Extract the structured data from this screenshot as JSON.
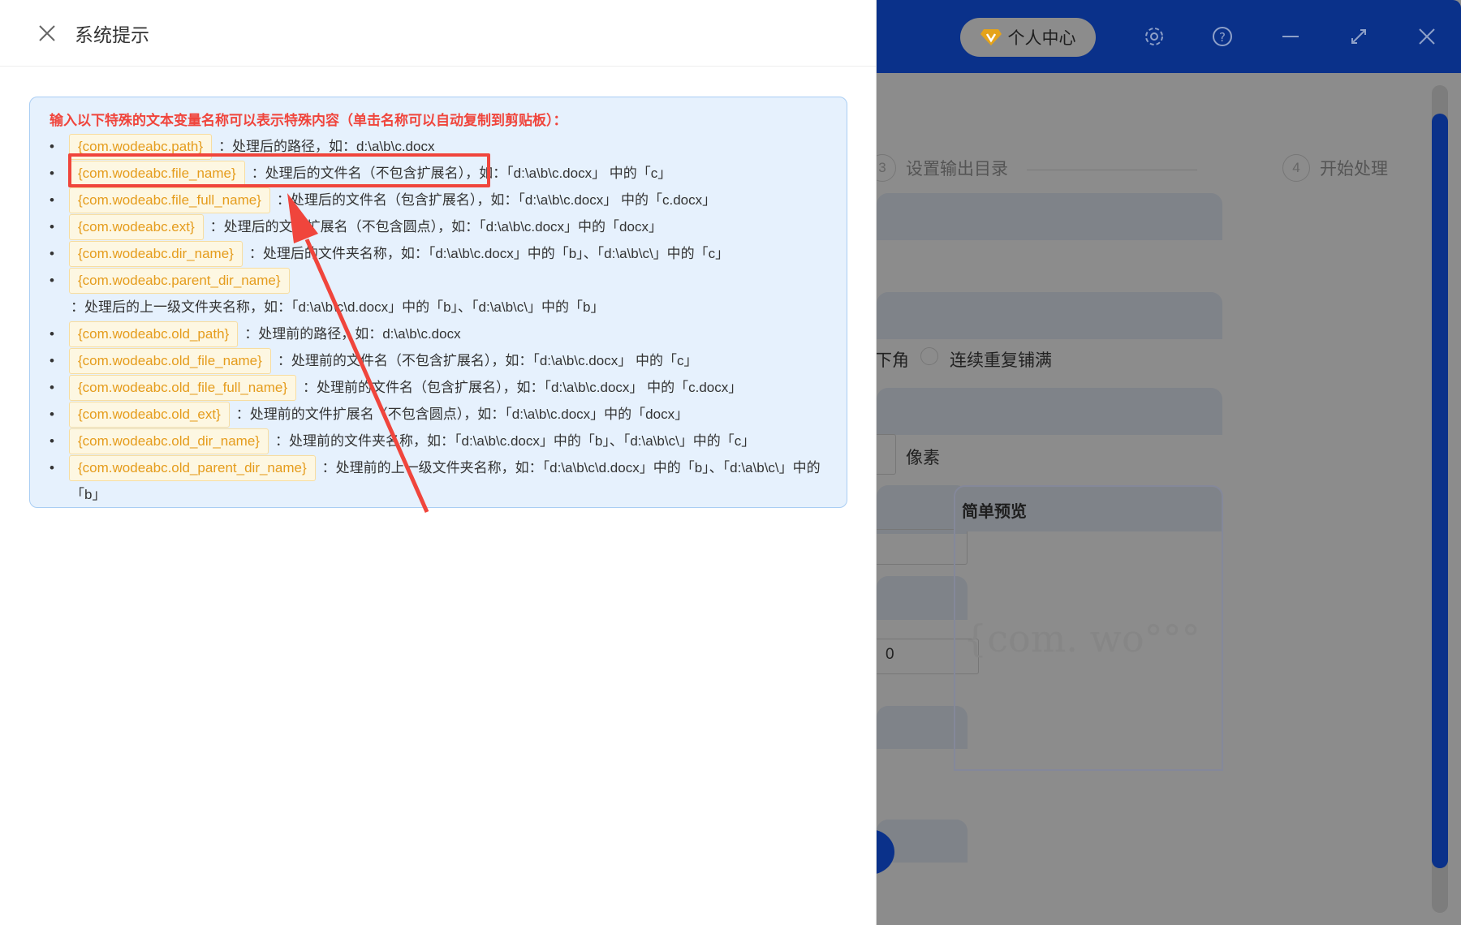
{
  "app": {
    "personal_center": "个人中心",
    "steps": [
      {
        "num": "3",
        "label": "设置输出目录"
      },
      {
        "num": "4",
        "label": "开始处理"
      }
    ],
    "radio_label_partial": "下角",
    "radio_option": "连续重复铺满",
    "unit": "像素",
    "input_value": "0",
    "preview_title": "简单预览",
    "preview_text": "{com. wo°°°"
  },
  "dialog": {
    "title": "系统提示",
    "heading": "输入以下特殊的文本变量名称可以表示特殊内容（单击名称可以自动复制到剪贴板）：",
    "items": [
      {
        "name": "{com.wodeabc.path}",
        "desc": "：处理后的路径，如：d:\\a\\b\\c.docx"
      },
      {
        "name": "{com.wodeabc.file_name}",
        "desc": "：处理后的文件名（不包含扩展名），如：「d:\\a\\b\\c.docx」 中的「c」"
      },
      {
        "name": "{com.wodeabc.file_full_name}",
        "desc": "：处理后的文件名（包含扩展名），如：「d:\\a\\b\\c.docx」 中的「c.docx」"
      },
      {
        "name": "{com.wodeabc.ext}",
        "desc": "：处理后的文件扩展名（不包含圆点），如：「d:\\a\\b\\c.docx」中的「docx」"
      },
      {
        "name": "{com.wodeabc.dir_name}",
        "desc": "：处理后的文件夹名称，如：「d:\\a\\b\\c.docx」中的「b」、「d:\\a\\b\\c\\」中的「c」"
      },
      {
        "name": "{com.wodeabc.parent_dir_name}",
        "desc": "：处理后的上一级文件夹名称，如：「d:\\a\\b\\c\\d.docx」中的「b」、「d:\\a\\b\\c\\」中的「b」"
      },
      {
        "name": "{com.wodeabc.old_path}",
        "desc": "：处理前的路径，如：d:\\a\\b\\c.docx"
      },
      {
        "name": "{com.wodeabc.old_file_name}",
        "desc": "：处理前的文件名（不包含扩展名），如：「d:\\a\\b\\c.docx」 中的「c」"
      },
      {
        "name": "{com.wodeabc.old_file_full_name}",
        "desc": "：处理前的文件名（包含扩展名），如：「d:\\a\\b\\c.docx」 中的「c.docx」"
      },
      {
        "name": "{com.wodeabc.old_ext}",
        "desc": "：处理前的文件扩展名（不包含圆点），如：「d:\\a\\b\\c.docx」中的「docx」"
      },
      {
        "name": "{com.wodeabc.old_dir_name}",
        "desc": "：处理前的文件夹名称，如：「d:\\a\\b\\c.docx」中的「b」、「d:\\a\\b\\c\\」中的「c」"
      },
      {
        "name": "{com.wodeabc.old_parent_dir_name}",
        "desc": "：处理前的上一级文件夹名称，如：「d:\\a\\b\\c\\d.docx」中的「b」、「d:\\a\\b\\c\\」中的「b」"
      }
    ]
  },
  "colors": {
    "brand": "#0a318a",
    "highlight": "#f0453c",
    "chip_text": "#e59c1c"
  }
}
